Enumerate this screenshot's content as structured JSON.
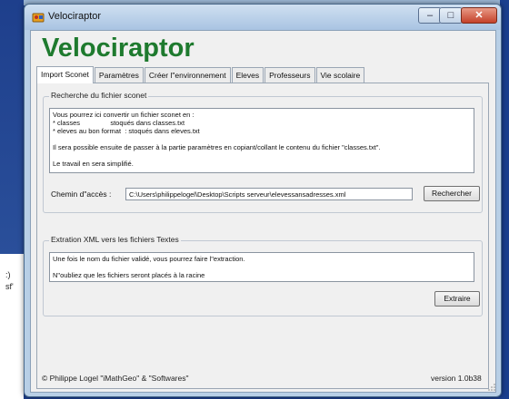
{
  "window": {
    "title": "Velociraptor",
    "minimize_glyph": "–",
    "maximize_glyph": "□",
    "close_glyph": "✕"
  },
  "app": {
    "heading": "Velociraptor",
    "heading_color": "#1e7a2e"
  },
  "tabs": [
    {
      "label": "Import Sconet",
      "active": true
    },
    {
      "label": "Paramètres"
    },
    {
      "label": "Créer l\"environnement"
    },
    {
      "label": "Eleves"
    },
    {
      "label": "Professeurs"
    },
    {
      "label": "Vie scolaire"
    }
  ],
  "sconet_group": {
    "legend": "Recherche du fichier sconet",
    "info_lines": [
      "Vous pourrez ici convertir un fichier sconet en :",
      "* classes                stoqués dans classes.txt",
      "* eleves au bon format  : stoqués dans eleves.txt",
      "",
      "Il sera possible ensuite de passer à la partie paramètres en copiant/collant le contenu du fichier \"classes.txt\".",
      "",
      "Le travail en sera simplifié."
    ],
    "path_label": "Chemin d\"accès :",
    "path_value": "C:\\Users\\philippelogel\\Desktop\\Scripts serveur\\elevessansadresses.xml",
    "search_button": "Rechercher"
  },
  "xml_group": {
    "legend": "Extration XML vers les fichiers Textes",
    "info_lines": [
      "Une fois le nom du fichier validé, vous pourrez faire l\"extraction.",
      "",
      "N\"oubliez que les fichiers seront placés à la racine"
    ],
    "extract_button": "Extraire"
  },
  "footer": {
    "credits": "© Philippe Logel \"iMathGeo\" & \"Softwares\"",
    "version": "version  1.0b38"
  },
  "desktop": {
    "fragment_1": ":)",
    "fragment_2": "sf'"
  }
}
